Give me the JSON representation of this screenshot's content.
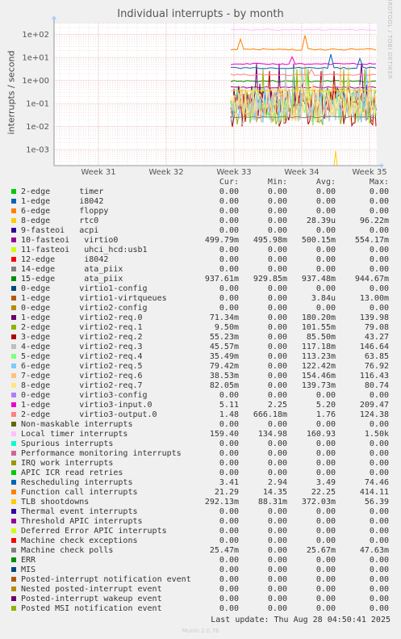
{
  "chart_data": {
    "type": "line",
    "title": "Individual interrupts - by month",
    "ylabel": "interrupts / second",
    "yscale": "log",
    "ylim": [
      0.0002,
      300
    ],
    "yticks": [
      "1e+02",
      "1e+01",
      "1e+00",
      "1e-01",
      "1e-02",
      "1e-03"
    ],
    "ytick_values": [
      100,
      10,
      1,
      0.1,
      0.01,
      0.001
    ],
    "xticks": [
      "Week 31",
      "Week 32",
      "Week 33",
      "Week 34",
      "Week 35"
    ],
    "grid": true,
    "columns": [
      "Cur:",
      "Min:",
      "Avg:",
      "Max:"
    ],
    "series": [
      {
        "name": "2-edge      timer",
        "color": "#00cc00",
        "cur": "0.00",
        "min": "0.00",
        "avg": "0.00",
        "max": "0.00"
      },
      {
        "name": "1-edge      i8042",
        "color": "#0066b3",
        "cur": "0.00",
        "min": "0.00",
        "avg": "0.00",
        "max": "0.00"
      },
      {
        "name": "6-edge      floppy",
        "color": "#ff8000",
        "cur": "0.00",
        "min": "0.00",
        "avg": "0.00",
        "max": "0.00"
      },
      {
        "name": "8-edge      rtc0",
        "color": "#ffcc00",
        "cur": "0.00",
        "min": "0.00",
        "avg": "28.39u",
        "max": "96.22m"
      },
      {
        "name": "9-fasteoi   acpi",
        "color": "#330099",
        "cur": "0.00",
        "min": "0.00",
        "avg": "0.00",
        "max": "0.00"
      },
      {
        "name": "10-fasteoi   virtio0",
        "color": "#990099",
        "cur": "499.79m",
        "min": "495.98m",
        "avg": "500.15m",
        "max": "554.17m"
      },
      {
        "name": "11-fasteoi   uhci_hcd:usb1",
        "color": "#ccff00",
        "cur": "0.00",
        "min": "0.00",
        "avg": "0.00",
        "max": "0.00"
      },
      {
        "name": "12-edge      i8042",
        "color": "#ff0000",
        "cur": "0.00",
        "min": "0.00",
        "avg": "0.00",
        "max": "0.00"
      },
      {
        "name": "14-edge      ata_piix",
        "color": "#808080",
        "cur": "0.00",
        "min": "0.00",
        "avg": "0.00",
        "max": "0.00"
      },
      {
        "name": "15-edge      ata_piix",
        "color": "#008f00",
        "cur": "937.61m",
        "min": "929.85m",
        "avg": "937.48m",
        "max": "944.67m"
      },
      {
        "name": "0-edge      virtio1-config",
        "color": "#00487d",
        "cur": "0.00",
        "min": "0.00",
        "avg": "0.00",
        "max": "0.00"
      },
      {
        "name": "1-edge      virtio1-virtqueues",
        "color": "#b35a00",
        "cur": "0.00",
        "min": "0.00",
        "avg": "3.84u",
        "max": "13.00m"
      },
      {
        "name": "0-edge      virtio2-config",
        "color": "#b38f00",
        "cur": "0.00",
        "min": "0.00",
        "avg": "0.00",
        "max": "0.00"
      },
      {
        "name": "1-edge      virtio2-req.0",
        "color": "#6b006b",
        "cur": "71.34m",
        "min": "0.00",
        "avg": "180.20m",
        "max": "139.98"
      },
      {
        "name": "2-edge      virtio2-req.1",
        "color": "#8fb300",
        "cur": "9.50m",
        "min": "0.00",
        "avg": "101.55m",
        "max": "79.08"
      },
      {
        "name": "3-edge      virtio2-req.2",
        "color": "#b30000",
        "cur": "55.23m",
        "min": "0.00",
        "avg": "85.50m",
        "max": "43.27"
      },
      {
        "name": "4-edge      virtio2-req.3",
        "color": "#bebebe",
        "cur": "45.57m",
        "min": "0.00",
        "avg": "117.18m",
        "max": "146.64"
      },
      {
        "name": "5-edge      virtio2-req.4",
        "color": "#80ff80",
        "cur": "35.49m",
        "min": "0.00",
        "avg": "113.23m",
        "max": "63.85"
      },
      {
        "name": "6-edge      virtio2-req.5",
        "color": "#80c9ff",
        "cur": "79.42m",
        "min": "0.00",
        "avg": "122.42m",
        "max": "76.92"
      },
      {
        "name": "7-edge      virtio2-req.6",
        "color": "#ffc080",
        "cur": "38.53m",
        "min": "0.00",
        "avg": "154.46m",
        "max": "116.43"
      },
      {
        "name": "8-edge      virtio2-req.7",
        "color": "#ffe680",
        "cur": "82.05m",
        "min": "0.00",
        "avg": "139.73m",
        "max": "80.74"
      },
      {
        "name": "0-edge      virtio3-config",
        "color": "#aa80ff",
        "cur": "0.00",
        "min": "0.00",
        "avg": "0.00",
        "max": "0.00"
      },
      {
        "name": "1-edge      virtio3-input.0",
        "color": "#ee00cc",
        "cur": "5.11",
        "min": "2.25",
        "avg": "5.20",
        "max": "209.47"
      },
      {
        "name": "2-edge      virtio3-output.0",
        "color": "#ff8080",
        "cur": "1.48",
        "min": "666.18m",
        "avg": "1.76",
        "max": "124.38"
      },
      {
        "name": "Non-maskable interrupts",
        "color": "#666600",
        "cur": "0.00",
        "min": "0.00",
        "avg": "0.00",
        "max": "0.00"
      },
      {
        "name": "Local timer interrupts",
        "color": "#ffbfff",
        "cur": "159.40",
        "min": "134.98",
        "avg": "160.93",
        "max": "1.50k"
      },
      {
        "name": "Spurious interrupts",
        "color": "#00ffcc",
        "cur": "0.00",
        "min": "0.00",
        "avg": "0.00",
        "max": "0.00"
      },
      {
        "name": "Performance monitoring interrupts",
        "color": "#cc6699",
        "cur": "0.00",
        "min": "0.00",
        "avg": "0.00",
        "max": "0.00"
      },
      {
        "name": "IRQ work interrupts",
        "color": "#999900",
        "cur": "0.00",
        "min": "0.00",
        "avg": "0.00",
        "max": "0.00"
      },
      {
        "name": "APIC ICR read retries",
        "color": "#00cc00",
        "cur": "0.00",
        "min": "0.00",
        "avg": "0.00",
        "max": "0.00"
      },
      {
        "name": "Rescheduling interrupts",
        "color": "#0066b3",
        "cur": "3.41",
        "min": "2.94",
        "avg": "3.49",
        "max": "74.46"
      },
      {
        "name": "Function call interrupts",
        "color": "#ff8000",
        "cur": "21.29",
        "min": "14.35",
        "avg": "22.25",
        "max": "414.11"
      },
      {
        "name": "TLB shootdowns",
        "color": "#ffcc00",
        "cur": "292.13m",
        "min": "88.31m",
        "avg": "372.03m",
        "max": "56.39"
      },
      {
        "name": "Thermal event interrupts",
        "color": "#330099",
        "cur": "0.00",
        "min": "0.00",
        "avg": "0.00",
        "max": "0.00"
      },
      {
        "name": "Threshold APIC interrupts",
        "color": "#990099",
        "cur": "0.00",
        "min": "0.00",
        "avg": "0.00",
        "max": "0.00"
      },
      {
        "name": "Deferred Error APIC interrupts",
        "color": "#ccff00",
        "cur": "0.00",
        "min": "0.00",
        "avg": "0.00",
        "max": "0.00"
      },
      {
        "name": "Machine check exceptions",
        "color": "#ff0000",
        "cur": "0.00",
        "min": "0.00",
        "avg": "0.00",
        "max": "0.00"
      },
      {
        "name": "Machine check polls",
        "color": "#808080",
        "cur": "25.47m",
        "min": "0.00",
        "avg": "25.67m",
        "max": "47.63m"
      },
      {
        "name": "ERR",
        "color": "#008f00",
        "cur": "0.00",
        "min": "0.00",
        "avg": "0.00",
        "max": "0.00"
      },
      {
        "name": "MIS",
        "color": "#00487d",
        "cur": "0.00",
        "min": "0.00",
        "avg": "0.00",
        "max": "0.00"
      },
      {
        "name": "Posted-interrupt notification event",
        "color": "#b35a00",
        "cur": "0.00",
        "min": "0.00",
        "avg": "0.00",
        "max": "0.00"
      },
      {
        "name": "Nested posted-interrupt event",
        "color": "#b38f00",
        "cur": "0.00",
        "min": "0.00",
        "avg": "0.00",
        "max": "0.00"
      },
      {
        "name": "Posted-interrupt wakeup event",
        "color": "#6b006b",
        "cur": "0.00",
        "min": "0.00",
        "avg": "0.00",
        "max": "0.00"
      },
      {
        "name": "Posted MSI notification event",
        "color": "#8fb300",
        "cur": "0.00",
        "min": "0.00",
        "avg": "0.00",
        "max": "0.00"
      }
    ]
  },
  "sidebar_text": "RRDTOOL / TOBI OETIKER",
  "last_update": "Last update: Thu Aug 28 04:50:41 2025",
  "footer": "Munin 2.0.76"
}
